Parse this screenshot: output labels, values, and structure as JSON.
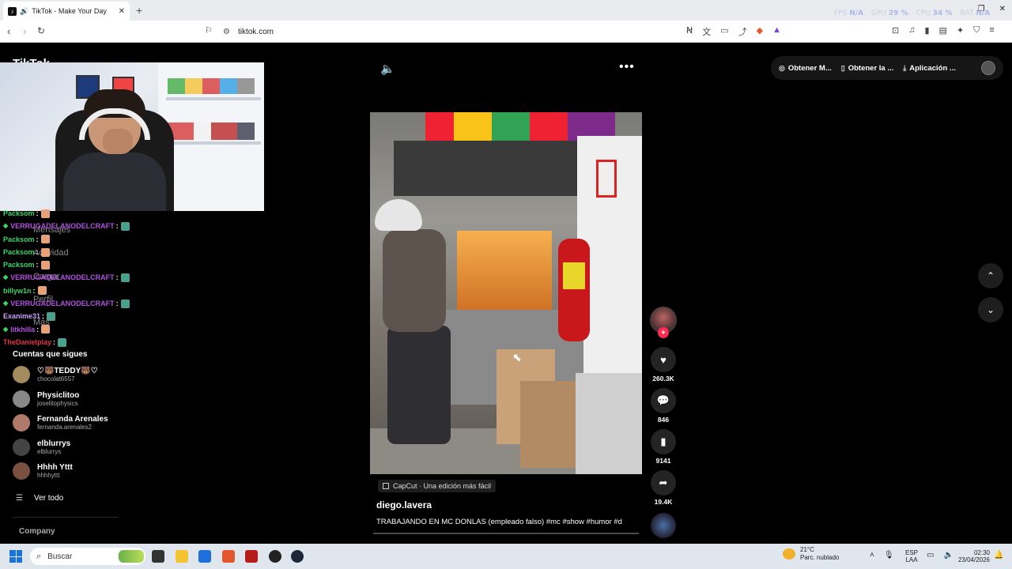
{
  "browser": {
    "tab_title": "TikTok - Make Your Day",
    "url": "tiktok.com",
    "perf": {
      "fps_label": "FPS",
      "fps_value": "N/A",
      "gpu_label": "GPU",
      "gpu_value": "29 %",
      "cpu_label": "CPU",
      "cpu_value": "34 %",
      "bat_label": "BAT",
      "bat_value": "N/A"
    }
  },
  "tiktok": {
    "logo": "TikTok",
    "ghost_nav": [
      "Mensajes",
      "Actividad",
      "Cargar",
      "Perfil",
      "Más"
    ],
    "chat": [
      {
        "user": "Packsom",
        "color": "#38d66b",
        "badge": false,
        "emote": "skin"
      },
      {
        "user": "VERRUGADELANODELCRAFT",
        "color": "#b24fe0",
        "badge": true,
        "emote": "green"
      },
      {
        "user": "Packsom",
        "color": "#38d66b",
        "badge": false,
        "emote": "skin"
      },
      {
        "user": "Packsom",
        "color": "#38d66b",
        "badge": false,
        "emote": "skin"
      },
      {
        "user": "Packsom",
        "color": "#38d66b",
        "badge": false,
        "emote": "skin"
      },
      {
        "user": "VERRUGADELANODELCRAFT",
        "color": "#b24fe0",
        "badge": true,
        "emote": "green"
      },
      {
        "user": "billyw1n",
        "color": "#38d66b",
        "badge": false,
        "emote": "skin"
      },
      {
        "user": "VERRUGADELANODELCRAFT",
        "color": "#b24fe0",
        "badge": true,
        "emote": "green"
      },
      {
        "user": "Exanime31",
        "color": "#c8a0ff",
        "badge": false,
        "emote": "green"
      },
      {
        "user": "litkhilla",
        "color": "#b24fe0",
        "badge": true,
        "emote": "skin"
      },
      {
        "user": "TheDanielplay",
        "color": "#e0334a",
        "badge": false,
        "emote": "green"
      }
    ],
    "following_header": "Cuentas que sigues",
    "following": [
      {
        "name": "♡🐻TEDDY🐻♡",
        "handle": "chocolat6557",
        "avatar": "#a48b5e"
      },
      {
        "name": "Physiclitoo",
        "handle": "joselitophysics",
        "avatar": "#888"
      },
      {
        "name": "Fernanda Arenales",
        "handle": "fernanda.arenales2",
        "avatar": "#b07a6a"
      },
      {
        "name": "elblurrys",
        "handle": "elblurrys",
        "avatar": "#444"
      },
      {
        "name": "Hhhh Yttt",
        "handle": "hhhhyttt",
        "avatar": "#7a5040"
      }
    ],
    "see_all": "Ver todo",
    "company": "Company",
    "top_buttons": [
      {
        "icon": "◎",
        "label": "Obtener M..."
      },
      {
        "icon": "▯",
        "label": "Obtener la ..."
      },
      {
        "icon": "⤓",
        "label": "Aplicación ..."
      }
    ],
    "video": {
      "capcut": "CapCut · Una edición más fácil",
      "author": "diego.lavera",
      "description": "TRABAJANDO EN MC DONLAS (empleado falso) #mc #show #humor #d",
      "progress": 0
    },
    "actions": {
      "likes": "260.3K",
      "comments": "846",
      "saves": "9141",
      "shares": "19.4K"
    }
  },
  "taskbar": {
    "search_placeholder": "Buscar",
    "weather_temp": "21°C",
    "weather_desc": "Parc. nublado",
    "lang_top": "ESP",
    "lang_bottom": "LAA",
    "time": "02:30",
    "date": "23/04/2026"
  }
}
